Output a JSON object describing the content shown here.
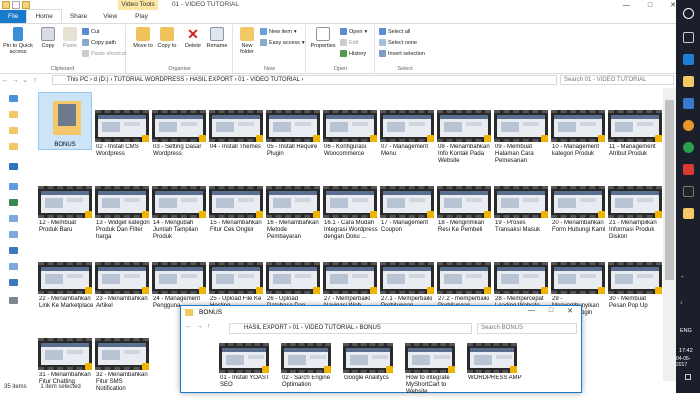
{
  "window": {
    "title": "01 - VIDEO TUTORIAL",
    "context_tab": "Video Tools"
  },
  "ribbon_tabs": [
    "File",
    "Home",
    "Share",
    "View",
    "Play"
  ],
  "ribbon": {
    "clipboard": {
      "pin_label": "Pin to Quick access",
      "copy_label": "Copy",
      "paste_label": "Paste",
      "cut_label": "Cut",
      "copy_path_label": "Copy path",
      "paste_shortcut_label": "Paste shortcut",
      "group_label": "Clipboard"
    },
    "organise": {
      "move_label": "Move to",
      "copy_to_label": "Copy to",
      "delete_label": "Delete",
      "rename_label": "Rename",
      "group_label": "Organise"
    },
    "new": {
      "new_folder_label": "New folder",
      "new_item_label": "New item",
      "easy_access_label": "Easy access",
      "group_label": "New"
    },
    "open": {
      "properties_label": "Properties",
      "open_label": "Open",
      "edit_label": "Edit",
      "history_label": "History",
      "group_label": "Open"
    },
    "select": {
      "select_all_label": "Select all",
      "select_none_label": "Select none",
      "invert_label": "Invert selection",
      "group_label": "Select"
    }
  },
  "address": {
    "path": "This PC  ›  d (D:)  ›  TUTORIAL WORDPRESS  ›  HASIL EXPORT  ›  01 - VIDEO TUTORIAL  ›",
    "search_placeholder": "Search 01 - VIDEO TUTORIAL"
  },
  "folder_item": {
    "label": "BONUS"
  },
  "files": [
    "02 - Install CMS Wordpress",
    "03 - Setting Dasar Wordpress",
    "04 - Install Themes",
    "05 - Install Require Plugin",
    "06 - Konfigurasi Woocommerce",
    "07 - Management Menu",
    "08 - Menambahkan Info Kontak Pada Website",
    "09 - Membuat Halaman Cara Pemesanan",
    "10 - Management kategori Produk",
    "11 - Management Atribut Produk",
    "12 - Membuat Produk Baru",
    "13 - Widget kategori Produk Dan Filter harga",
    "14 - Mengubah Jumlah Tampilan Produk",
    "15 - Menambahkan Fitur Cek Ongkir",
    "16 - Menambahkan Metode Pembayaran",
    "16.1 - Cara Mudah Integrasi Wordpress dengan Doku ...",
    "17 - Management Coupon",
    "18 - Mengirimkan Resi Ke Pembeli",
    "19 - Proses Transaksi Masuk",
    "20 - Menambahkan Form Hubungi Kami",
    "21 - Menampilkan Informasi Produk Diskon",
    "22 - Menambahkan Link Ke Marketplace",
    "23 - Menambahkan Artikel",
    "24 - Management Pengguna",
    "25 - Upload File Ke Hosting",
    "26 - Upload Database Dan Konfigurasi",
    "27 - Memperbaiki Navigasi Web",
    "27.1 - Memperbaiki Perhitungan",
    "27.2 - memperbaiki Perhitungan",
    "28 - Mempercepat Loading Website",
    "29 - Menyembunyikan Halaman Login",
    "30 - Membuat Pesan Pop Up",
    "31 - Menambahkan Fitur Chatting",
    "32 - Menambahkan Fitur SMS Notification"
  ],
  "status": {
    "items_count": "35 items",
    "selected": "1 item selected"
  },
  "bonus_window": {
    "title": "BONUS",
    "path": "HASIL EXPORT  ›  01 - VIDEO TUTORIAL  ›  BONUS",
    "search_placeholder": "Search BONUS",
    "files": [
      "01 - Install YOAST SEO",
      "02 - Sarch Engine Optimation",
      "Google Analitycs",
      "How to integrate MyShortCart to Website",
      "WORDPRESS AMP"
    ]
  },
  "tray": {
    "lang": "ENG",
    "time": "17:42",
    "date": "04-05-2017"
  }
}
